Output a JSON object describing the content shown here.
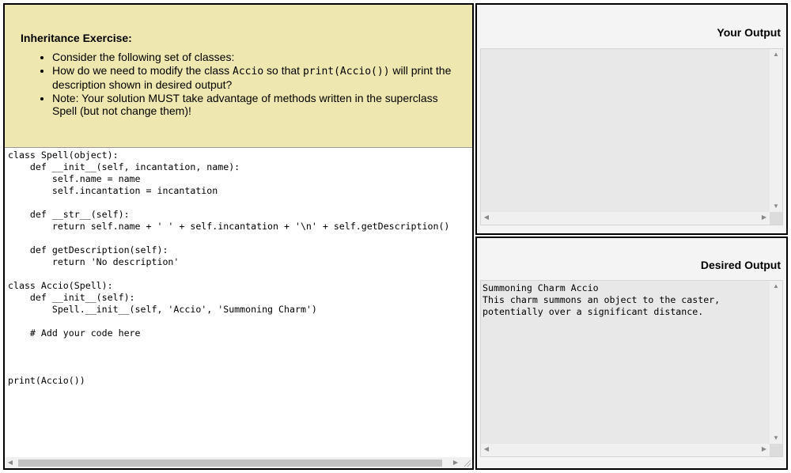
{
  "instructions": {
    "title": "Inheritance Exercise:",
    "bullet1": "Consider the following set of classes:",
    "bullet2_pre": "How do we need to modify the class ",
    "bullet2_code1": "Accio",
    "bullet2_mid": " so that ",
    "bullet2_code2": "print(Accio())",
    "bullet2_post": " will print the description shown in desired output?",
    "bullet3": "Note: Your solution MUST take advantage of methods written in the superclass Spell (but not change them)!"
  },
  "editor": {
    "code": "class Spell(object):\n    def __init__(self, incantation, name):\n        self.name = name\n        self.incantation = incantation\n\n    def __str__(self):\n        return self.name + ' ' + self.incantation + '\\n' + self.getDescription()\n\n    def getDescription(self):\n        return 'No description'\n\nclass Accio(Spell):\n    def __init__(self):\n        Spell.__init__(self, 'Accio', 'Summoning Charm')\n\n    # Add your code here\n\n\n\nprint(Accio())"
  },
  "your_output": {
    "title": "Your Output",
    "text": ""
  },
  "desired_output": {
    "title": "Desired Output",
    "text": "Summoning Charm Accio\nThis charm summons an object to the caster,\npotentially over a significant distance."
  },
  "icons": {
    "up": "scroll-up-arrow-icon",
    "down": "scroll-down-arrow-icon",
    "left": "scroll-left-arrow-icon",
    "right": "scroll-right-arrow-icon"
  }
}
